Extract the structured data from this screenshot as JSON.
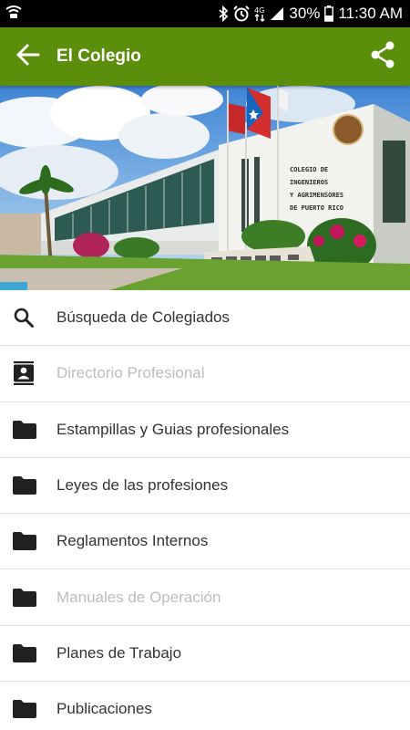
{
  "status_bar": {
    "battery_percent": "30%",
    "time": "11:30 AM",
    "icons": [
      "wifi-calling-icon",
      "bluetooth-icon",
      "alarm-icon",
      "data-icon",
      "signal-icon",
      "battery-icon"
    ]
  },
  "app_bar": {
    "title": "El Colegio",
    "color": "#5b8f0b",
    "icons": [
      "back-arrow-icon",
      "share-icon"
    ]
  },
  "hero": {
    "description_icon": "building-photo",
    "sign_text": [
      "COLEGIO DE",
      "INGENIEROS",
      "Y AGRIMENSORES",
      "DE PUERTO RICO"
    ]
  },
  "menu": {
    "items": [
      {
        "label": "Búsqueda de Colegiados",
        "icon": "search-icon",
        "enabled": true
      },
      {
        "label": "Directorio Profesional",
        "icon": "contact-card-icon",
        "enabled": false
      },
      {
        "label": "Estampillas y Guias profesionales",
        "icon": "folder-icon",
        "enabled": true
      },
      {
        "label": "Leyes de las profesiones",
        "icon": "folder-icon",
        "enabled": true
      },
      {
        "label": "Reglamentos Internos",
        "icon": "folder-icon",
        "enabled": true
      },
      {
        "label": "Manuales de Operación",
        "icon": "folder-icon",
        "enabled": false
      },
      {
        "label": "Planes de Trabajo",
        "icon": "folder-icon",
        "enabled": true
      },
      {
        "label": "Publicaciones",
        "icon": "folder-icon",
        "enabled": true
      }
    ]
  }
}
